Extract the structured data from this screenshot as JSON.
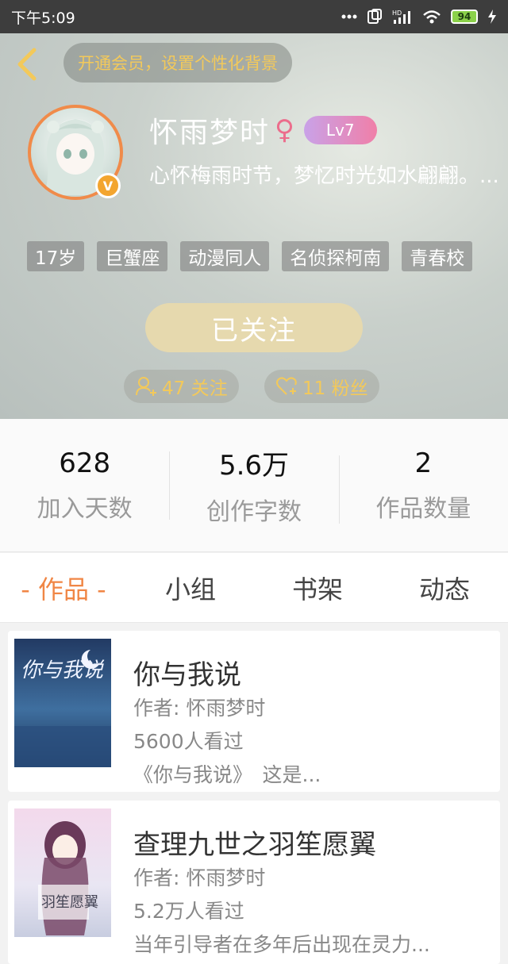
{
  "status_bar": {
    "time": "下午5:09",
    "battery": "94",
    "icons": [
      "more-icon",
      "screen-mirror-icon",
      "hd-signal-icon",
      "wifi-icon",
      "battery-icon",
      "charging-icon"
    ]
  },
  "header": {
    "vip_prompt": "开通会员，设置个性化背景",
    "username": "怀雨梦时",
    "gender_symbol": "♀",
    "level": "Lv7",
    "avatar_badge": "V",
    "bio": "心怀梅雨时节，梦忆时光如水翩翩。...",
    "tags": [
      "17岁",
      "巨蟹座",
      "动漫同人",
      "名侦探柯南",
      "青春校"
    ],
    "follow_button": "已关注",
    "following": "47 关注",
    "fans": "11 粉丝"
  },
  "stats": [
    {
      "value": "628",
      "label": "加入天数"
    },
    {
      "value": "5.6万",
      "label": "创作字数"
    },
    {
      "value": "2",
      "label": "作品数量"
    }
  ],
  "tabs": [
    {
      "label": "- 作品 -",
      "active": true
    },
    {
      "label": "小组",
      "active": false
    },
    {
      "label": "书架",
      "active": false
    },
    {
      "label": "动态",
      "active": false
    }
  ],
  "books": [
    {
      "title": "你与我说",
      "author": "作者: 怀雨梦时",
      "views": "5600人看过",
      "desc": "《你与我说》　这是...",
      "cover_text": "你与我说"
    },
    {
      "title": "查理九世之羽笙愿翼",
      "author": "作者: 怀雨梦时",
      "views": "5.2万人看过",
      "desc": "当年引导者在多年后出现在灵力...",
      "cover_text": "羽笙愿翼"
    }
  ],
  "colors": {
    "accent_orange": "#f08645",
    "vip_gold": "#f3c95a",
    "status_bar": "#3d3d3d"
  }
}
